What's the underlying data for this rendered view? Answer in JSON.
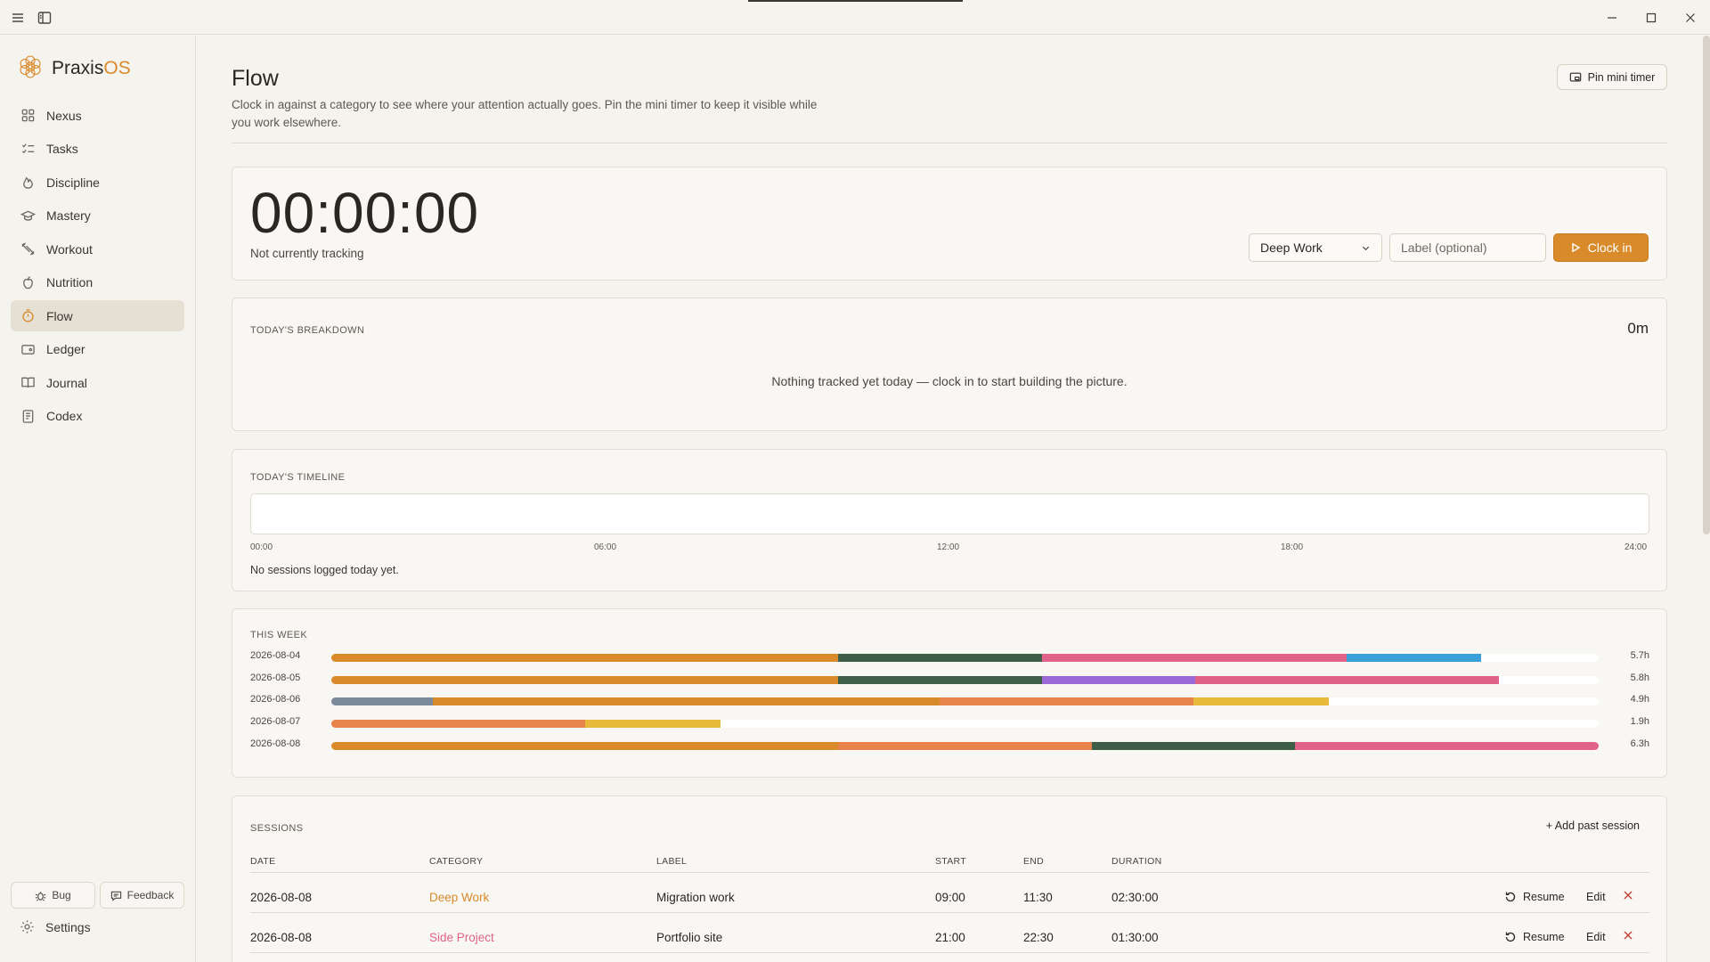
{
  "brand": {
    "name_prefix": "Praxis",
    "name_suffix": "OS"
  },
  "sidebar": {
    "items": [
      {
        "label": "Nexus",
        "icon": "grid-icon"
      },
      {
        "label": "Tasks",
        "icon": "checklist-icon"
      },
      {
        "label": "Discipline",
        "icon": "flame-icon"
      },
      {
        "label": "Mastery",
        "icon": "graduation-cap-icon"
      },
      {
        "label": "Workout",
        "icon": "dumbbell-icon"
      },
      {
        "label": "Nutrition",
        "icon": "apple-icon"
      },
      {
        "label": "Flow",
        "icon": "timer-icon"
      },
      {
        "label": "Ledger",
        "icon": "wallet-icon"
      },
      {
        "label": "Journal",
        "icon": "book-icon"
      },
      {
        "label": "Codex",
        "icon": "notebook-icon"
      }
    ],
    "active": "Flow",
    "bug_label": "Bug",
    "feedback_label": "Feedback",
    "settings_label": "Settings"
  },
  "header": {
    "title": "Flow",
    "description": "Clock in against a category to see where your attention actually goes. Pin the mini timer to keep it visible while you work elsewhere.",
    "pin_label": "Pin mini timer"
  },
  "timer": {
    "display": "00:00:00",
    "status": "Not currently tracking",
    "category": "Deep Work",
    "label_placeholder": "Label (optional)",
    "clock_in_label": "Clock in"
  },
  "breakdown": {
    "heading": "TODAY'S BREAKDOWN",
    "total": "0m",
    "empty": "Nothing tracked yet today — clock in to start building the picture."
  },
  "timeline": {
    "heading": "TODAY'S TIMELINE",
    "ticks": [
      "00:00",
      "06:00",
      "12:00",
      "18:00",
      "24:00"
    ],
    "empty": "No sessions logged today yet."
  },
  "week": {
    "heading": "THIS WEEK",
    "max_hours": 7.1,
    "days": [
      {
        "date": "2026-08-04",
        "hours_label": "5.7h",
        "segments": [
          {
            "hours": 2.84,
            "color": "#d98a2b"
          },
          {
            "hours": 1.14,
            "color": "#3f5e48"
          },
          {
            "hours": 1.71,
            "color": "#e0628b"
          },
          {
            "hours": 0.75,
            "color": "#3aa0d8"
          }
        ]
      },
      {
        "date": "2026-08-05",
        "hours_label": "5.8h",
        "segments": [
          {
            "hours": 2.84,
            "color": "#d98a2b"
          },
          {
            "hours": 1.14,
            "color": "#3f5e48"
          },
          {
            "hours": 0.86,
            "color": "#9b6ad8"
          },
          {
            "hours": 1.7,
            "color": "#e0628b"
          }
        ]
      },
      {
        "date": "2026-08-06",
        "hours_label": "4.9h",
        "segments": [
          {
            "hours": 0.57,
            "color": "#7d8a9a"
          },
          {
            "hours": 2.84,
            "color": "#d98a2b"
          },
          {
            "hours": 1.42,
            "color": "#e8844a"
          },
          {
            "hours": 0.76,
            "color": "#e8b93a"
          }
        ]
      },
      {
        "date": "2026-08-07",
        "hours_label": "1.9h",
        "segments": [
          {
            "hours": 1.42,
            "color": "#e8844a"
          },
          {
            "hours": 0.76,
            "color": "#e8b93a"
          }
        ]
      },
      {
        "date": "2026-08-08",
        "hours_label": "6.3h",
        "segments": [
          {
            "hours": 2.84,
            "color": "#d98a2b"
          },
          {
            "hours": 1.42,
            "color": "#e8844a"
          },
          {
            "hours": 1.14,
            "color": "#3f5e48"
          },
          {
            "hours": 1.7,
            "color": "#e0628b"
          }
        ]
      }
    ]
  },
  "sessions": {
    "heading": "SESSIONS",
    "add_label": "+ Add past session",
    "columns": {
      "date": "DATE",
      "category": "CATEGORY",
      "label": "LABEL",
      "start": "START",
      "end": "END",
      "duration": "DURATION"
    },
    "resume_label": "Resume",
    "edit_label": "Edit",
    "rows": [
      {
        "date": "2026-08-08",
        "category": "Deep Work",
        "category_color": "#d98a2b",
        "label": "Migration work",
        "start": "09:00",
        "end": "11:30",
        "duration": "02:30:00"
      },
      {
        "date": "2026-08-08",
        "category": "Side Project",
        "category_color": "#e0628b",
        "label": "Portfolio site",
        "start": "21:00",
        "end": "22:30",
        "duration": "01:30:00"
      }
    ]
  }
}
